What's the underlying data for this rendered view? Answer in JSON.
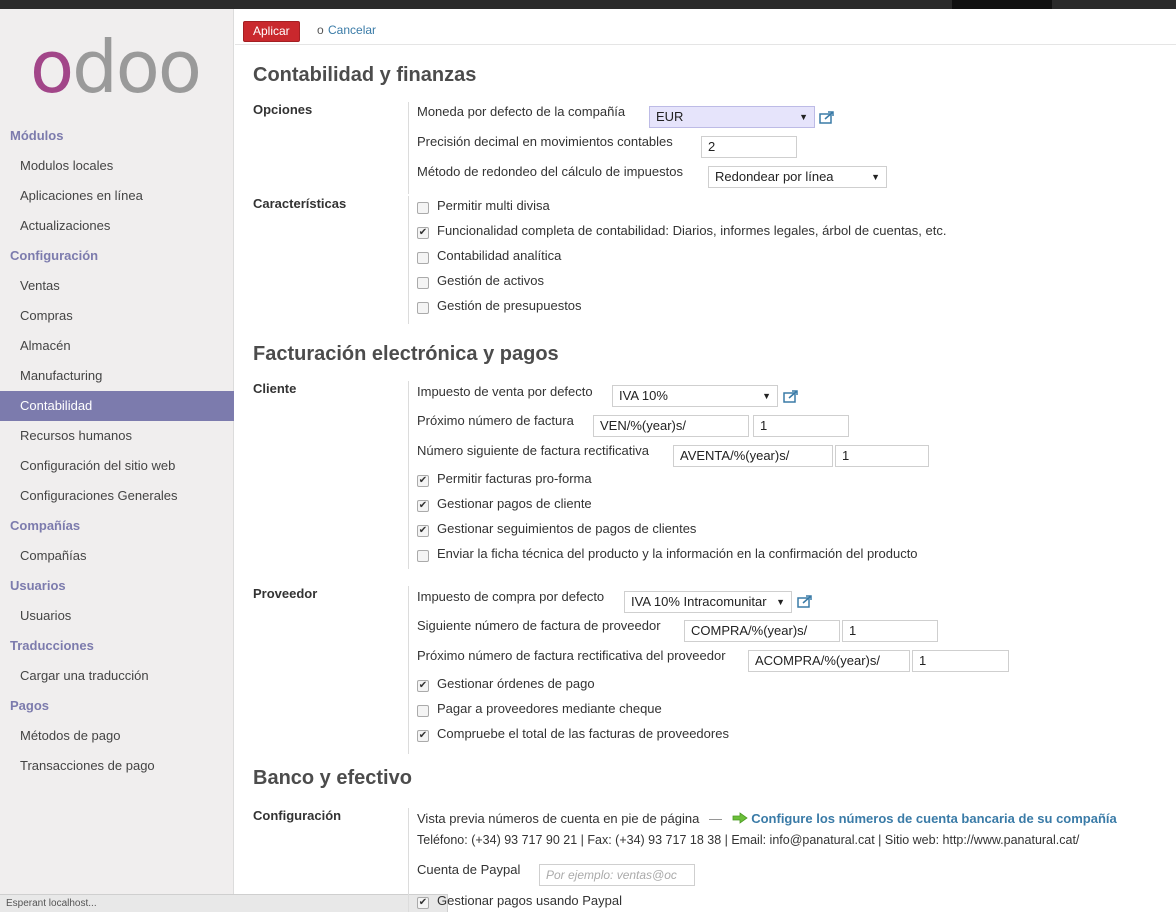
{
  "logo": {
    "first": "o",
    "rest": "doo"
  },
  "sidebar": [
    {
      "type": "head",
      "label": "Módulos"
    },
    {
      "type": "item",
      "label": "Modulos locales"
    },
    {
      "type": "item",
      "label": "Aplicaciones en línea"
    },
    {
      "type": "item",
      "label": "Actualizaciones"
    },
    {
      "type": "head",
      "label": "Configuración"
    },
    {
      "type": "item",
      "label": "Ventas"
    },
    {
      "type": "item",
      "label": "Compras"
    },
    {
      "type": "item",
      "label": "Almacén"
    },
    {
      "type": "item",
      "label": "Manufacturing"
    },
    {
      "type": "item",
      "label": "Contabilidad",
      "active": true
    },
    {
      "type": "item",
      "label": "Recursos humanos"
    },
    {
      "type": "item",
      "label": "Configuración del sitio web"
    },
    {
      "type": "item",
      "label": "Configuraciones Generales"
    },
    {
      "type": "head",
      "label": "Compañías"
    },
    {
      "type": "item",
      "label": "Compañías"
    },
    {
      "type": "head",
      "label": "Usuarios"
    },
    {
      "type": "item",
      "label": "Usuarios"
    },
    {
      "type": "head",
      "label": "Traducciones"
    },
    {
      "type": "item",
      "label": "Cargar una traducción"
    },
    {
      "type": "head",
      "label": "Pagos"
    },
    {
      "type": "item",
      "label": "Métodos de pago"
    },
    {
      "type": "item",
      "label": "Transacciones de pago"
    }
  ],
  "status_text": "Esperant localhost...",
  "actions": {
    "apply": "Aplicar",
    "or": "o",
    "cancel": "Cancelar"
  },
  "sections": {
    "accounting": {
      "title": "Contabilidad y finanzas",
      "options_label": "Opciones",
      "currency_label": "Moneda por defecto de la compañía",
      "currency_value": "EUR",
      "precision_label": "Precisión decimal en movimientos contables",
      "precision_value": "2",
      "rounding_label": "Método de redondeo del cálculo de impuestos",
      "rounding_value": "Redondear por línea",
      "features_label": "Características",
      "features": [
        {
          "label": "Permitir multi divisa",
          "checked": false
        },
        {
          "label": "Funcionalidad completa de contabilidad: Diarios, informes legales, árbol de cuentas, etc.",
          "checked": true
        },
        {
          "label": "Contabilidad analítica",
          "checked": false
        },
        {
          "label": "Gestión de activos",
          "checked": false
        },
        {
          "label": "Gestión de presupuestos",
          "checked": false
        }
      ]
    },
    "invoicing": {
      "title": "Facturación electrónica y pagos",
      "customer_label": "Cliente",
      "sale_tax_label": "Impuesto de venta por defecto",
      "sale_tax_value": "IVA 10%",
      "next_invoice_label": "Próximo número de factura",
      "next_invoice_prefix": "VEN/%(year)s/",
      "next_invoice_number": "1",
      "next_refund_label": "Número siguiente de factura rectificativa",
      "next_refund_prefix": "AVENTA/%(year)s/",
      "next_refund_number": "1",
      "customer_checks": [
        {
          "label": "Permitir facturas pro-forma",
          "checked": true
        },
        {
          "label": "Gestionar pagos de cliente",
          "checked": true
        },
        {
          "label": "Gestionar seguimientos de pagos de clientes",
          "checked": true
        },
        {
          "label": "Enviar la ficha técnica del producto y la información en la confirmación del producto",
          "checked": false
        }
      ],
      "supplier_label": "Proveedor",
      "purchase_tax_label": "Impuesto de compra por defecto",
      "purchase_tax_value": "IVA 10% Intracomunitar",
      "supplier_invoice_label": "Siguiente número de factura de proveedor",
      "supplier_invoice_prefix": "COMPRA/%(year)s/",
      "supplier_invoice_number": "1",
      "supplier_refund_label": "Próximo número de factura rectificativa del proveedor",
      "supplier_refund_prefix": "ACOMPRA/%(year)s/",
      "supplier_refund_number": "1",
      "supplier_checks": [
        {
          "label": "Gestionar órdenes de pago",
          "checked": true
        },
        {
          "label": "Pagar a proveedores mediante cheque",
          "checked": false
        },
        {
          "label": "Compruebe el total de las facturas de proveedores",
          "checked": true
        }
      ]
    },
    "bank": {
      "title": "Banco y efectivo",
      "config_label": "Configuración",
      "preview_label": "Vista previa números de cuenta en pie de página",
      "preview_dash": "—",
      "configure_link": "Configure los números de cuenta bancaria de su compañía",
      "footer_text": "Teléfono: (+34) 93 717 90 21 | Fax: (+34) 93 717 18 38 | Email: info@panatural.cat | Sitio web: http://www.panatural.cat/",
      "paypal_label": "Cuenta de Paypal",
      "paypal_placeholder": "Por ejemplo: ventas@oc",
      "paypal_check": {
        "label": "Gestionar pagos usando Paypal",
        "checked": true
      }
    }
  },
  "colors": {
    "brand": "#a24689",
    "accent": "#7c7bad",
    "apply": "#c9282d",
    "link": "#3a7ba7"
  }
}
